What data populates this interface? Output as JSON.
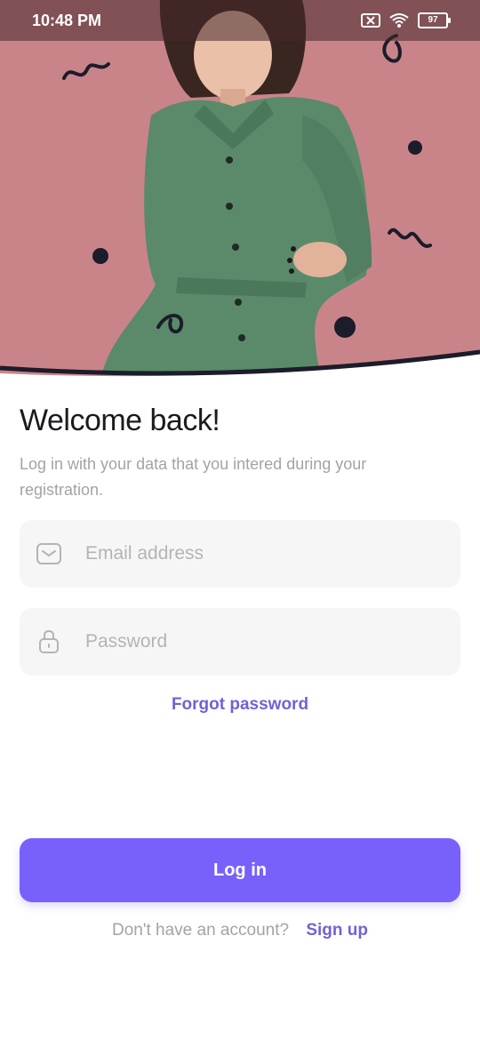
{
  "status_bar": {
    "time": "10:48 PM",
    "battery": "97"
  },
  "hero": {
    "image": "woman-in-green-shirt-dress-photo"
  },
  "welcome": {
    "title": "Welcome back!",
    "subtitle": "Log in with your data that you intered during your registration."
  },
  "form": {
    "email_placeholder": "Email address",
    "password_placeholder": "Password",
    "email_icon": "mail-icon",
    "password_icon": "lock-icon"
  },
  "forgot_label": "Forgot password",
  "login_label": "Log in",
  "signup": {
    "question": "Don't have an account?",
    "link": "Sign up"
  },
  "colors": {
    "accent": "#7860fb",
    "accent_text": "#7460d6",
    "hero_background": "#c9848a",
    "dress_green": "#5a8a6a"
  }
}
